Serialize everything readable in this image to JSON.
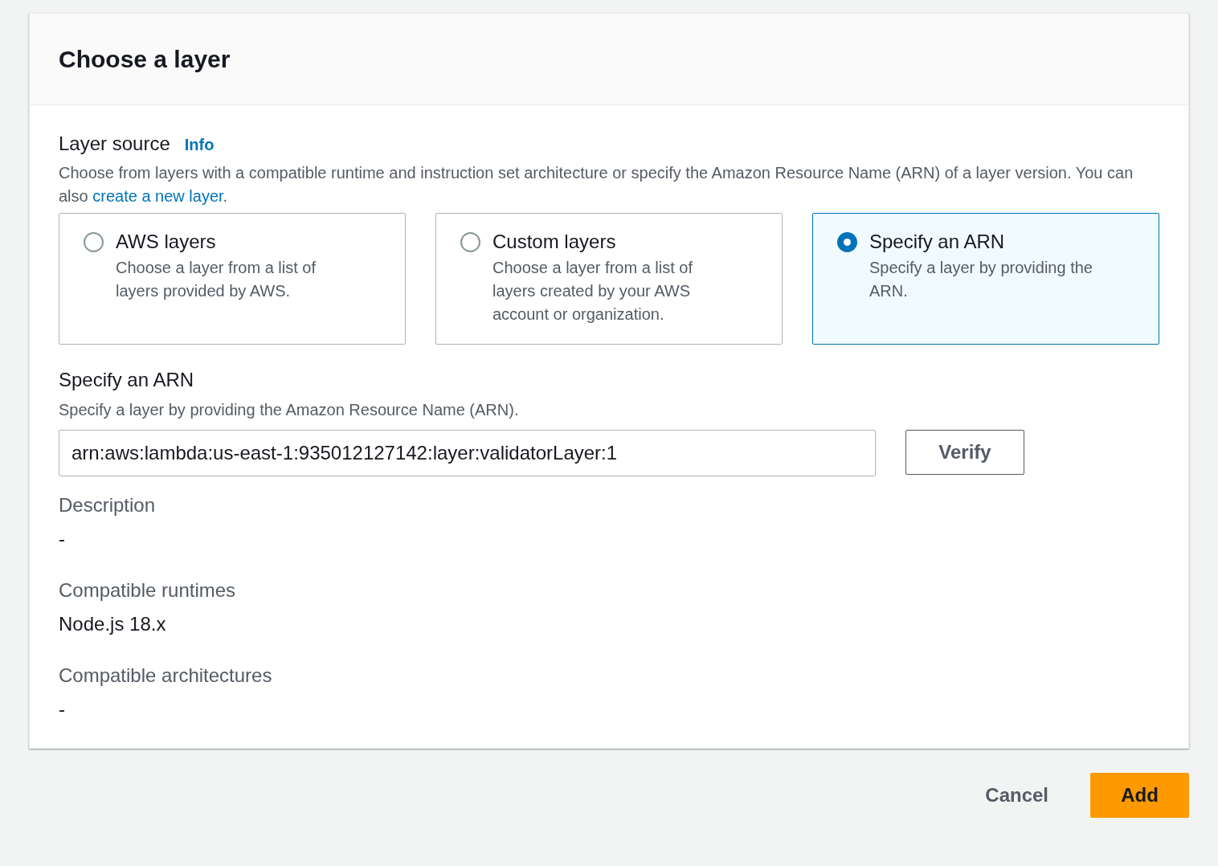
{
  "title": "Choose a layer",
  "layer_source": {
    "label": "Layer source",
    "info": "Info",
    "description_before": "Choose from layers with a compatible runtime and instruction set architecture or specify the Amazon Resource Name (ARN) of a layer version. You can also",
    "link": "create a new layer",
    "description_after": "."
  },
  "options": [
    {
      "title": "AWS layers",
      "description": "Choose a layer from a list of layers provided by AWS.",
      "selected": false
    },
    {
      "title": "Custom layers",
      "description": "Choose a layer from a list of layers created by your AWS account or organization.",
      "selected": false
    },
    {
      "title": "Specify an ARN",
      "description": "Specify a layer by providing the ARN.",
      "selected": true
    }
  ],
  "arn": {
    "label": "Specify an ARN",
    "description": "Specify a layer by providing the Amazon Resource Name (ARN).",
    "value": "arn:aws:lambda:us-east-1:935012127142:layer:validatorLayer:1",
    "button": "Verify"
  },
  "details": [
    {
      "label": "Description",
      "value": "-"
    },
    {
      "label": "Compatible runtimes",
      "value": "Node.js 18.x"
    },
    {
      "label": "Compatible architectures",
      "value": "-"
    }
  ],
  "footer_buttons": [
    {
      "label": "Cancel",
      "kind": "link"
    },
    {
      "label": "Add",
      "kind": "primary"
    }
  ]
}
